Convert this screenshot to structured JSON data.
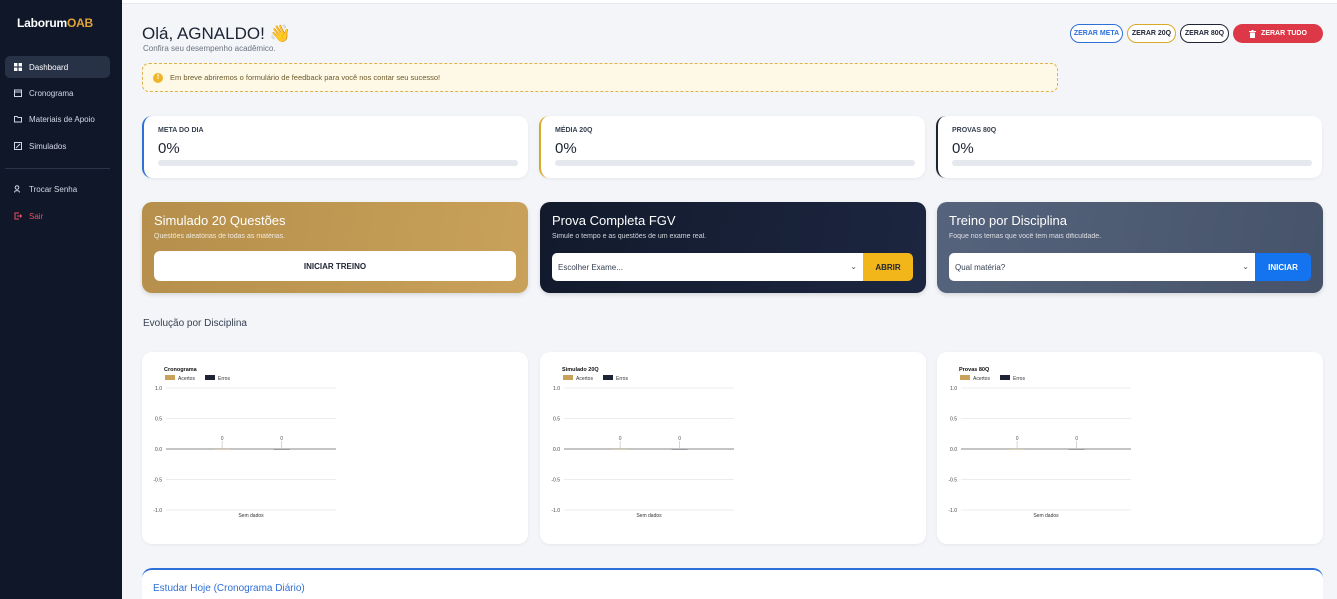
{
  "sidebar": {
    "logo_primary": "Laborum",
    "logo_accent": "OAB",
    "items": [
      {
        "label": "Dashboard",
        "icon": "grid-icon"
      },
      {
        "label": "Cronograma",
        "icon": "calendar-icon"
      },
      {
        "label": "Materiais de Apoio",
        "icon": "folder-icon"
      },
      {
        "label": "Simulados",
        "icon": "edit-icon"
      },
      {
        "label": "Trocar Senha",
        "icon": "key-user-icon"
      },
      {
        "label": "Sair",
        "icon": "logout-icon"
      }
    ]
  },
  "header": {
    "greeting": "Olá, AGNALDO! 👋",
    "subtitle": "Confira seu desempenho acadêmico.",
    "buttons": {
      "zerar_meta": "ZERAR META",
      "zerar_20q": "ZERAR 20Q",
      "zerar_80q": "ZERAR 80Q",
      "zerar_tudo": "ZERAR TUDO"
    }
  },
  "alert": {
    "icon": "!",
    "text": "Em breve abriremos o formulário de feedback para você nos contar seu sucesso!"
  },
  "stats": [
    {
      "label": "META DO DIA",
      "value": "0%",
      "progress": 0
    },
    {
      "label": "MÉDIA 20Q",
      "value": "0%",
      "progress": 0
    },
    {
      "label": "PROVAS 80Q",
      "value": "0%",
      "progress": 0
    }
  ],
  "actions": {
    "simulado": {
      "title": "Simulado 20 Questões",
      "desc": "Questões aleatórias de todas as matérias.",
      "button": "INICIAR TREINO"
    },
    "prova": {
      "title": "Prova Completa FGV",
      "desc": "Simule o tempo e as questões de um exame real.",
      "select": "Escolher Exame...",
      "button": "ABRIR"
    },
    "treino": {
      "title": "Treino por Disciplina",
      "desc": "Foque nos temas que você tem mais dificuldade.",
      "select": "Qual matéria?",
      "button": "INICIAR"
    }
  },
  "section_title": "Evolução por Disciplina",
  "colors": {
    "acertos": "#c9a15a",
    "erros": "#1e2433"
  },
  "chart_data": [
    {
      "type": "bar",
      "title": "Cronograma",
      "categories": [
        "Sem dados"
      ],
      "series": [
        {
          "name": "Acertos",
          "values": [
            0
          ]
        },
        {
          "name": "Erros",
          "values": [
            0
          ]
        }
      ],
      "ylim": [
        -1.0,
        1.0
      ],
      "yticks": [
        "1.0",
        "0.5",
        "0.0",
        "-0.5",
        "-1.0"
      ],
      "legend": "top-left",
      "grid": true
    },
    {
      "type": "bar",
      "title": "Simulado 20Q",
      "categories": [
        "Sem dados"
      ],
      "series": [
        {
          "name": "Acertos",
          "values": [
            0
          ]
        },
        {
          "name": "Erros",
          "values": [
            0
          ]
        }
      ],
      "ylim": [
        -1.0,
        1.0
      ],
      "yticks": [
        "1.0",
        "0.5",
        "0.0",
        "-0.5",
        "-1.0"
      ],
      "legend": "top-left",
      "grid": true
    },
    {
      "type": "bar",
      "title": "Provas 80Q",
      "categories": [
        "Sem dados"
      ],
      "series": [
        {
          "name": "Acertos",
          "values": [
            0
          ]
        },
        {
          "name": "Erros",
          "values": [
            0
          ]
        }
      ],
      "ylim": [
        -1.0,
        1.0
      ],
      "yticks": [
        "1.0",
        "0.5",
        "0.0",
        "-0.5",
        "-1.0"
      ],
      "legend": "top-left",
      "grid": true
    }
  ],
  "bottom": {
    "title": "Estudar Hoje (Cronograma Diário)"
  }
}
